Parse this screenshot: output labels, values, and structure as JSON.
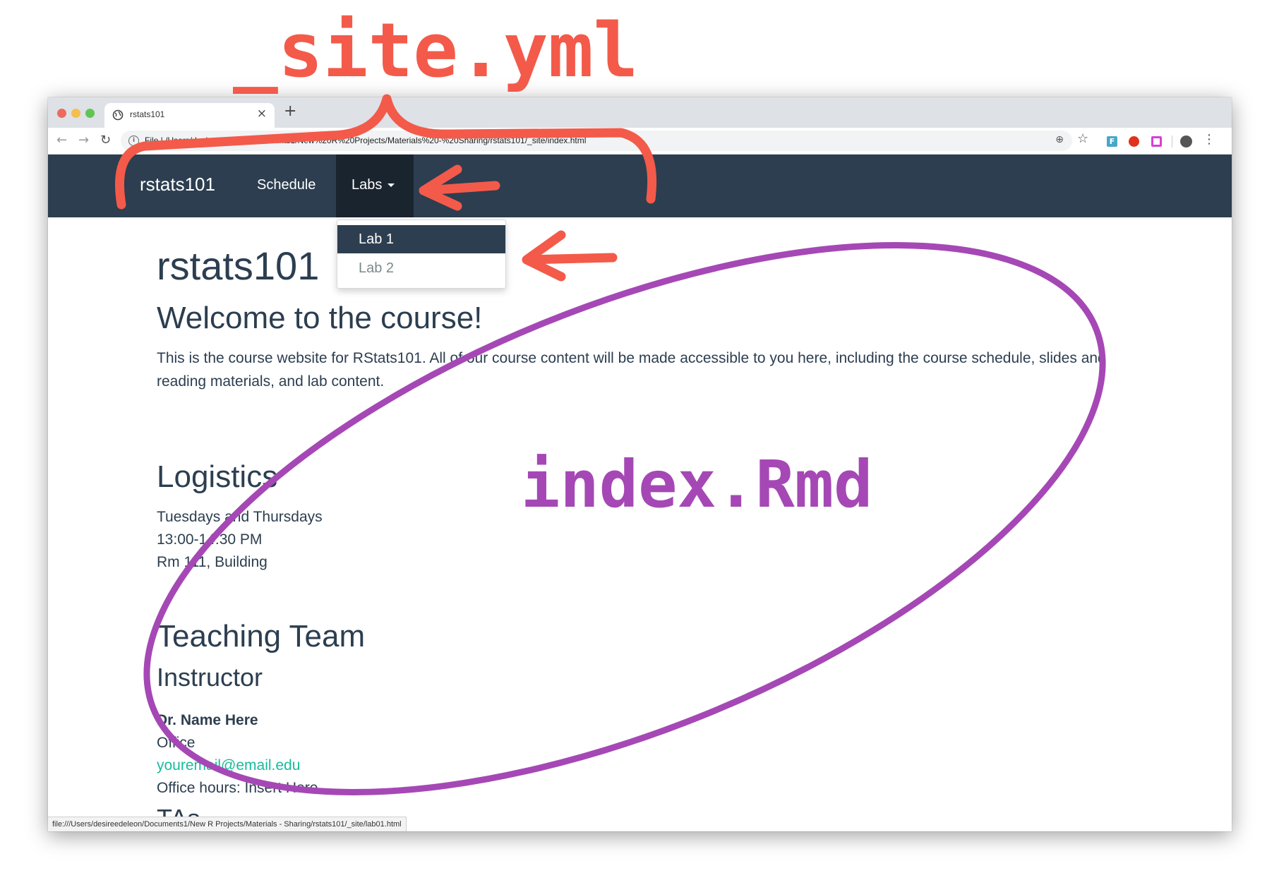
{
  "browser": {
    "tab_title": "rstats101",
    "url": "File | /Users/desireedeleon/Documents1/New%20R%20Projects/Materials%20-%20Sharing/rstats101/_site/index.html",
    "status_url": "file:///Users/desireedeleon/Documents1/New R Projects/Materials - Sharing/rstats101/_site/lab01.html",
    "extension_f_label": "F"
  },
  "navbar": {
    "brand": "rstats101",
    "schedule": "Schedule",
    "labs": "Labs",
    "dropdown": [
      "Lab 1",
      "Lab 2"
    ]
  },
  "content": {
    "title": "rstats101",
    "welcome": "Welcome to the course!",
    "intro": "This is the course website for RStats101. All of our course content will be made accessible to you here, including the course schedule, slides and reading materials, and lab content.",
    "logistics_heading": "Logistics",
    "logistics": [
      "Tuesdays and Thursdays",
      "13:00-14:30 PM",
      "Rm 111, Building"
    ],
    "team_heading": "Teaching Team",
    "instructor_heading": "Instructor",
    "instructor_name": "Dr. Name Here",
    "instructor_office": "Office",
    "instructor_email": "youremail@email.edu",
    "instructor_hours": "Office hours: Insert Here",
    "tas_heading": "TAs"
  },
  "annotations": {
    "top_label": "_site.yml",
    "center_label": "index.Rmd",
    "red_color": "#f35a4a",
    "purple_color": "#a548b5"
  }
}
